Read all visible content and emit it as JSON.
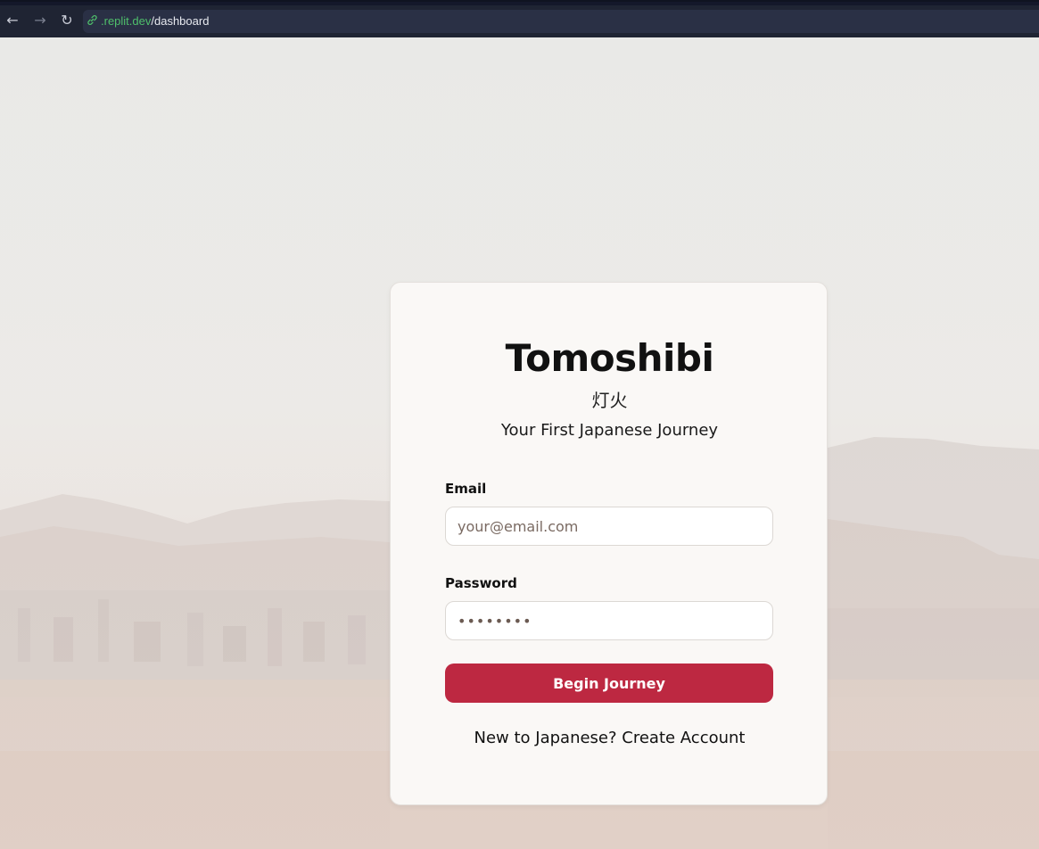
{
  "browser": {
    "url_domain": ".replit.dev",
    "url_path": "/dashboard",
    "back_icon": "←",
    "forward_icon": "→",
    "reload_icon": "↻",
    "link_icon": "🔗"
  },
  "login": {
    "title": "Tomoshibi",
    "kanji": "灯火",
    "subtitle": "Your First Japanese Journey",
    "email_label": "Email",
    "email_placeholder": "your@email.com",
    "password_label": "Password",
    "password_value": "••••••••",
    "submit_label": "Begin Journey",
    "signup_text": "New to Japanese? Create Account"
  },
  "colors": {
    "accent": "#bd2841",
    "card_background": "#faf8f6",
    "chrome_background": "#1f2433",
    "url_domain": "#4fbf6b"
  }
}
